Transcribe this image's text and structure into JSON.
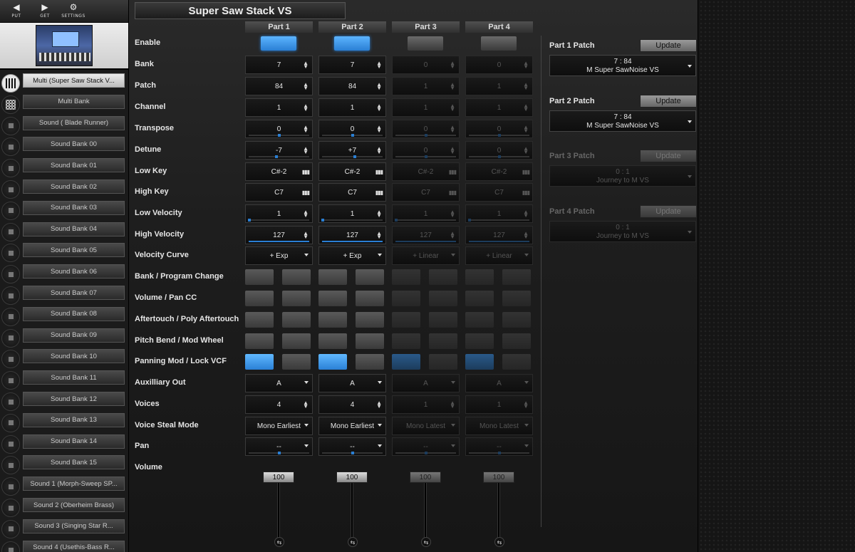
{
  "toolbar": {
    "put_label": "PUT",
    "get_label": "GET",
    "settings_label": "SETTINGS"
  },
  "sidebar": {
    "items": [
      {
        "label": "Multi (Super Saw Stack V...",
        "active": true,
        "icon": "grid-icon"
      },
      {
        "label": "Multi Bank",
        "active": false,
        "icon": "grid-icon"
      },
      {
        "label": "Sound (  Blade Runner)",
        "active": false,
        "icon": "square-icon"
      },
      {
        "label": "Sound Bank 00",
        "active": false,
        "icon": "square-icon"
      },
      {
        "label": "Sound Bank 01",
        "active": false,
        "icon": "square-icon"
      },
      {
        "label": "Sound Bank 02",
        "active": false,
        "icon": "square-icon"
      },
      {
        "label": "Sound Bank 03",
        "active": false,
        "icon": "square-icon"
      },
      {
        "label": "Sound Bank 04",
        "active": false,
        "icon": "square-icon"
      },
      {
        "label": "Sound Bank 05",
        "active": false,
        "icon": "square-icon"
      },
      {
        "label": "Sound Bank 06",
        "active": false,
        "icon": "square-icon"
      },
      {
        "label": "Sound Bank 07",
        "active": false,
        "icon": "square-icon"
      },
      {
        "label": "Sound Bank 08",
        "active": false,
        "icon": "square-icon"
      },
      {
        "label": "Sound Bank 09",
        "active": false,
        "icon": "square-icon"
      },
      {
        "label": "Sound Bank 10",
        "active": false,
        "icon": "square-icon"
      },
      {
        "label": "Sound Bank 11",
        "active": false,
        "icon": "square-icon"
      },
      {
        "label": "Sound Bank 12",
        "active": false,
        "icon": "square-icon"
      },
      {
        "label": "Sound Bank 13",
        "active": false,
        "icon": "square-icon"
      },
      {
        "label": "Sound Bank 14",
        "active": false,
        "icon": "square-icon"
      },
      {
        "label": "Sound Bank 15",
        "active": false,
        "icon": "square-icon"
      },
      {
        "label": "Sound 1 (Morph-Sweep   SP...",
        "active": false,
        "icon": "square-icon"
      },
      {
        "label": "Sound 2 (Oberheim Brass)",
        "active": false,
        "icon": "square-icon"
      },
      {
        "label": "Sound 3 (Singing Star   R...",
        "active": false,
        "icon": "square-icon"
      },
      {
        "label": "Sound 4 (Usethis-Bass   R...",
        "active": false,
        "icon": "square-icon"
      }
    ]
  },
  "main": {
    "title": "Super Saw Stack VS",
    "parts": [
      "Part 1",
      "Part 2",
      "Part 3",
      "Part 4"
    ],
    "labels": {
      "enable": "Enable",
      "bank": "Bank",
      "patch": "Patch",
      "channel": "Channel",
      "transpose": "Transpose",
      "detune": "Detune",
      "low_key": "Low Key",
      "high_key": "High Key",
      "low_velocity": "Low Velocity",
      "high_velocity": "High Velocity",
      "velocity_curve": "Velocity Curve",
      "bank_program_change": "Bank / Program Change",
      "volume_pan_cc": "Volume / Pan CC",
      "aftertouch": "Aftertouch / Poly Aftertouch",
      "pitch_bend": "Pitch Bend / Mod Wheel",
      "panning_mod": "Panning Mod / Lock VCF",
      "aux_out": "Auxilliary Out",
      "voices": "Voices",
      "voice_steal": "Voice Steal Mode",
      "pan": "Pan",
      "volume": "Volume"
    },
    "enabled": [
      true,
      true,
      false,
      false
    ],
    "values": {
      "bank": [
        "7",
        "7",
        "0",
        "0"
      ],
      "patch": [
        "84",
        "84",
        "1",
        "1"
      ],
      "channel": [
        "1",
        "1",
        "1",
        "1"
      ],
      "transpose": [
        "0",
        "0",
        "0",
        "0"
      ],
      "detune": [
        "-7",
        "+7",
        "0",
        "0"
      ],
      "low_key": [
        "C#-2",
        "C#-2",
        "C#-2",
        "C#-2"
      ],
      "high_key": [
        "C7",
        "C7",
        "C7",
        "C7"
      ],
      "low_velocity": [
        "1",
        "1",
        "1",
        "1"
      ],
      "high_velocity": [
        "127",
        "127",
        "127",
        "127"
      ],
      "velocity_curve": [
        "+ Exp",
        "+ Exp",
        "+ Linear",
        "+ Linear"
      ],
      "aux_out": [
        "A",
        "A",
        "A",
        "A"
      ],
      "voices": [
        "4",
        "4",
        "1",
        "1"
      ],
      "voice_steal": [
        "Mono Earliest",
        "Mono Earliest",
        "Mono Latest",
        "Mono Latest"
      ],
      "pan": [
        "--",
        "--",
        "--",
        "--"
      ],
      "volume": [
        "100",
        "100",
        "100",
        "100"
      ]
    },
    "toggles": {
      "bank_program_change": [
        [
          false,
          false
        ],
        [
          false,
          false
        ],
        [
          false,
          false
        ],
        [
          false,
          false
        ]
      ],
      "volume_pan_cc": [
        [
          false,
          false
        ],
        [
          false,
          false
        ],
        [
          false,
          false
        ],
        [
          false,
          false
        ]
      ],
      "aftertouch": [
        [
          false,
          false
        ],
        [
          false,
          false
        ],
        [
          false,
          false
        ],
        [
          false,
          false
        ]
      ],
      "pitch_bend": [
        [
          false,
          false
        ],
        [
          false,
          false
        ],
        [
          false,
          false
        ],
        [
          false,
          false
        ]
      ],
      "panning_mod": [
        [
          true,
          false
        ],
        [
          true,
          false
        ],
        [
          true,
          false
        ],
        [
          true,
          false
        ]
      ]
    },
    "patches": [
      {
        "label": "Part 1 Patch",
        "update": "Update",
        "line1": "7 : 84",
        "line2": "M Super SawNoise VS",
        "enabled": true
      },
      {
        "label": "Part 2 Patch",
        "update": "Update",
        "line1": "7 : 84",
        "line2": "M Super SawNoise VS",
        "enabled": true
      },
      {
        "label": "Part 3 Patch",
        "update": "Update",
        "line1": "0 : 1",
        "line2": "Journey to M VS",
        "enabled": false
      },
      {
        "label": "Part 4 Patch",
        "update": "Update",
        "line1": "0 : 1",
        "line2": "Journey to M VS",
        "enabled": false
      }
    ],
    "link_glyph": "⇆",
    "keyboard_glyph": "▮▮▮",
    "accent_color": "#2a7fd4"
  }
}
